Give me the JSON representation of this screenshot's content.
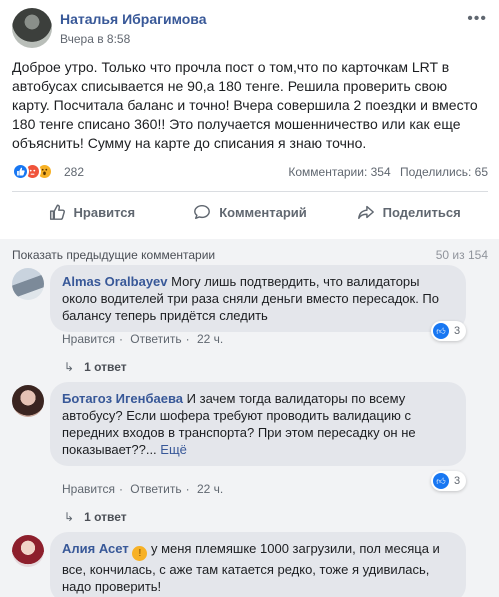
{
  "post": {
    "author": "Наталья Ибрагимова",
    "time": "Вчера в 8:58",
    "text": "Доброе утро. Только что прочла пост о том,что по карточкам LRT в автобусах списывается не 90,а 180 тенге. Решила проверить свою карту. Посчитала баланс и точно! Вчера совершила 2 поездки и вместо 180 тенге списано 360!! Это получается мошенничество или как еще объяснить! Сумму на карте до списания я знаю точно.",
    "reaction_count": "282",
    "comments_label": "Комментарии: 354",
    "shares_label": "Поделились: 65"
  },
  "actions": {
    "like": "Нравится",
    "comment": "Комментарий",
    "share": "Поделиться"
  },
  "comments_section": {
    "prev_link": "Показать предыдущие комментарии",
    "counter": "50 из 154"
  },
  "comments": [
    {
      "author": "Almas Oralbayev",
      "text": "Могу лишь подтвердить, что валидаторы около водителей три раза сняли деньги вместо пересадок. По балансу теперь придётся следить",
      "like": "Нравится",
      "reply": "Ответить",
      "time": "22 ч.",
      "replies": "1 ответ",
      "likes": "3"
    },
    {
      "author": "Ботагоз Игенбаева",
      "text": "И зачем тогда валидаторы по всему автобусу? Если шофера требуют проводить валидацию с передних входов в транспорта? При этом пересадку он не показывает??...",
      "more": "Ещё",
      "like": "Нравится",
      "reply": "Ответить",
      "time": "22 ч.",
      "replies": "1 ответ",
      "likes": "3"
    },
    {
      "author": "Алия Асет",
      "text": "у меня племяшке 1000 загрузили, пол месяца и все, кончилась, с аже там катается редко, тоже я удивилась, надо проверить!"
    }
  ],
  "icons": {
    "more": "more-horizontal-icon",
    "like": "thumbs-up-icon",
    "comment": "speech-bubble-icon",
    "share": "share-arrow-icon",
    "reply": "reply-arrow-icon"
  },
  "colors": {
    "link": "#385898",
    "like": "#1877f2",
    "bubble": "#e4e6eb",
    "comments_bg": "#f2f3f5"
  }
}
